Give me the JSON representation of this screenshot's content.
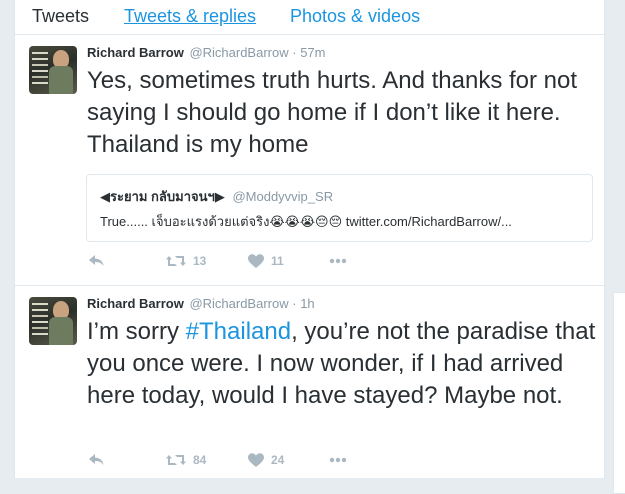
{
  "tabs": [
    "Tweets",
    "Tweets & replies",
    "Photos & videos"
  ],
  "tweets": [
    {
      "name": "Richard Barrow",
      "handle": "@RichardBarrow",
      "separator": "·",
      "time": "57m",
      "text": "Yes, sometimes truth hurts. And thanks for not saying I should go home if I don’t like it here. Thailand is my home",
      "quote": {
        "name": "◀ระยาม กลับมาจนฯ▶",
        "handle": "@Moddyvvip_SR",
        "text": "True...... เจ็บอะแรงด้วยแต่จริง😭😭😭😔😔 ",
        "link": "twitter.com/RichardBarrow/..."
      },
      "retweets": "13",
      "likes": "11"
    },
    {
      "name": "Richard Barrow",
      "handle": "@RichardBarrow",
      "separator": "·",
      "time": "1h",
      "text_before": "I’m sorry ",
      "hashtag": "#Thailand",
      "text_after": ", you’re not the paradise that you once were. I now wonder, if I had arrived here today, would I have stayed? Maybe not.",
      "retweets": "84",
      "likes": "24"
    }
  ],
  "icons": {
    "reply": "reply-icon",
    "retweet": "retweet-icon",
    "like": "heart-icon",
    "more": "more-icon"
  },
  "colors": {
    "link": "#1b95e0",
    "muted": "#8899a6",
    "icon": "#aab8c2"
  }
}
